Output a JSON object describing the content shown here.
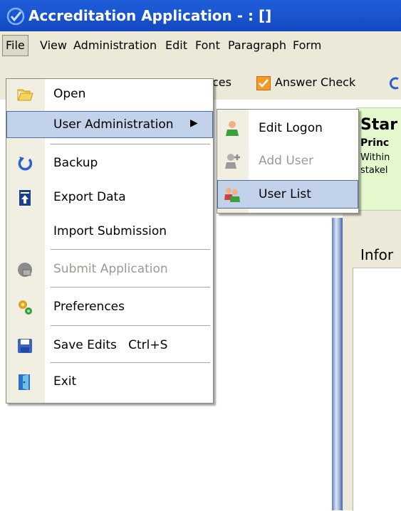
{
  "window": {
    "title": "Accreditation Application - : []"
  },
  "menubar": {
    "items": [
      "File",
      "View",
      "Administration",
      "Edit",
      "Font",
      "Paragraph",
      "Form"
    ]
  },
  "toolbar": {
    "partial_label": "ces",
    "answer_check_label": "Answer Check"
  },
  "file_menu": {
    "items": [
      {
        "label": "Open",
        "icon": "folder-icon",
        "enabled": true
      },
      {
        "label": "User Administration",
        "icon": "",
        "enabled": true,
        "submenu": true,
        "highlighted": true
      },
      {
        "label": "Backup",
        "icon": "backup-icon",
        "enabled": true
      },
      {
        "label": "Export Data",
        "icon": "export-icon",
        "enabled": true
      },
      {
        "label": "Import Submission",
        "icon": "",
        "enabled": true
      },
      {
        "label": "Submit Application",
        "icon": "submit-icon",
        "enabled": false
      },
      {
        "label": "Preferences",
        "icon": "preferences-icon",
        "enabled": true
      },
      {
        "label": "Save Edits   Ctrl+S",
        "icon": "save-icon",
        "enabled": true
      },
      {
        "label": "Exit",
        "icon": "exit-icon",
        "enabled": true
      }
    ],
    "submenu_arrow": "▶"
  },
  "user_admin_submenu": {
    "items": [
      {
        "label": "Edit Logon",
        "icon": "user-icon",
        "enabled": true
      },
      {
        "label": "Add User",
        "icon": "add-user-icon",
        "enabled": false
      },
      {
        "label": "User List",
        "icon": "users-icon",
        "enabled": true,
        "highlighted": true
      }
    ]
  },
  "background": {
    "panel_title": "Star",
    "panel_bold": "Princ",
    "panel_line1": "Within",
    "panel_line2": "stakel",
    "info_label": "Infor"
  },
  "colors": {
    "titlebar": "#1a55d0",
    "menu_highlight": "#c2d2ea",
    "menu_highlight_border": "#4b6ea9",
    "panel_green": "#e3f8cd",
    "disabled_text": "#9c9a90"
  }
}
